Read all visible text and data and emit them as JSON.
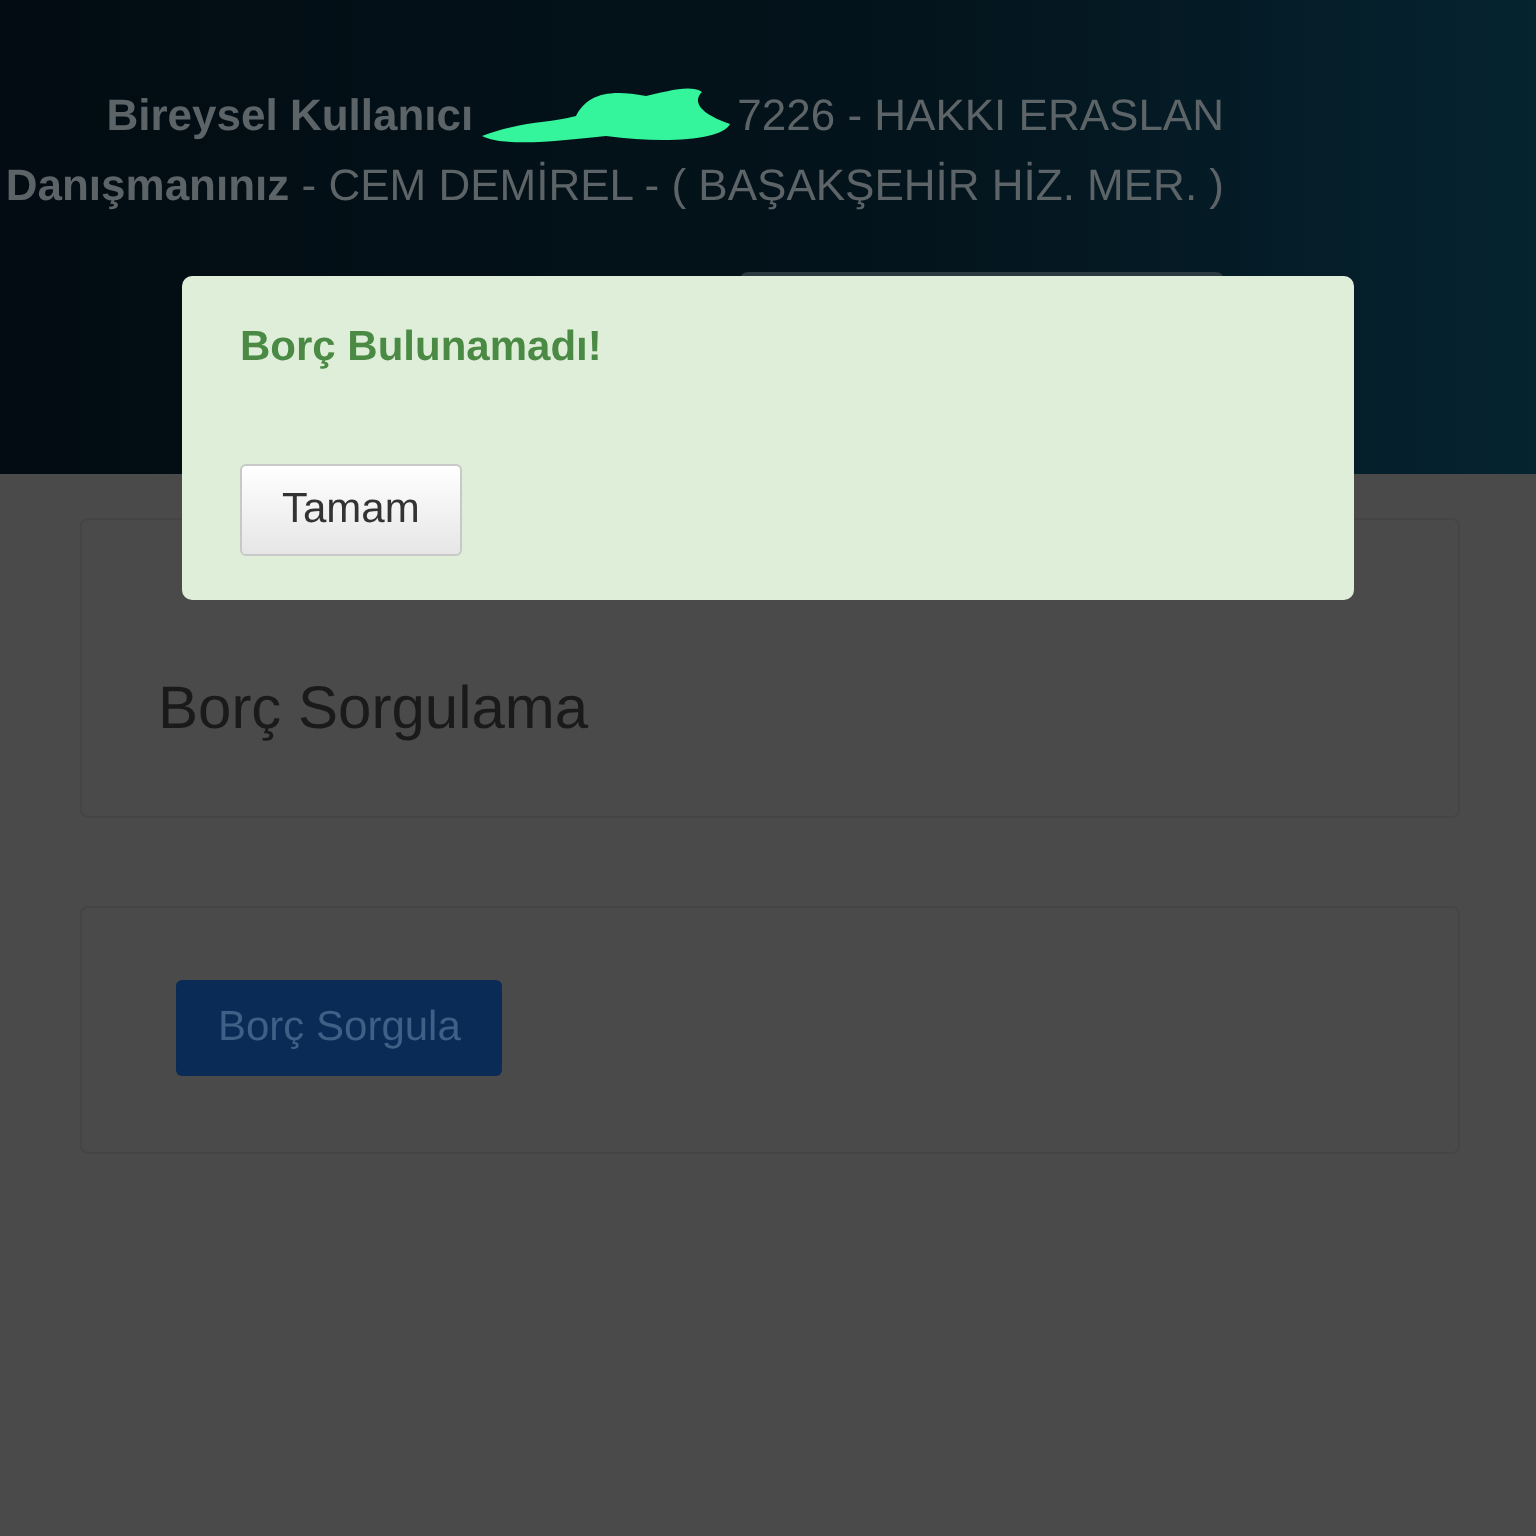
{
  "header": {
    "user_label": "Bireysel Kullanıcı",
    "user_value": "7226 - HAKKI ERASLAN",
    "advisor": "**Danışmanınız** - CEM DEMİREL - ( BAŞAKŞEHİR HİZ. MER. )"
  },
  "dialog": {
    "message": "Borç Bulunamadı!",
    "button": "Tamam"
  },
  "sections": [
    {
      "kind": "title",
      "text": "Borç Sorgulama"
    },
    {
      "kind": "button",
      "text": "Borç Sorgula"
    }
  ]
}
